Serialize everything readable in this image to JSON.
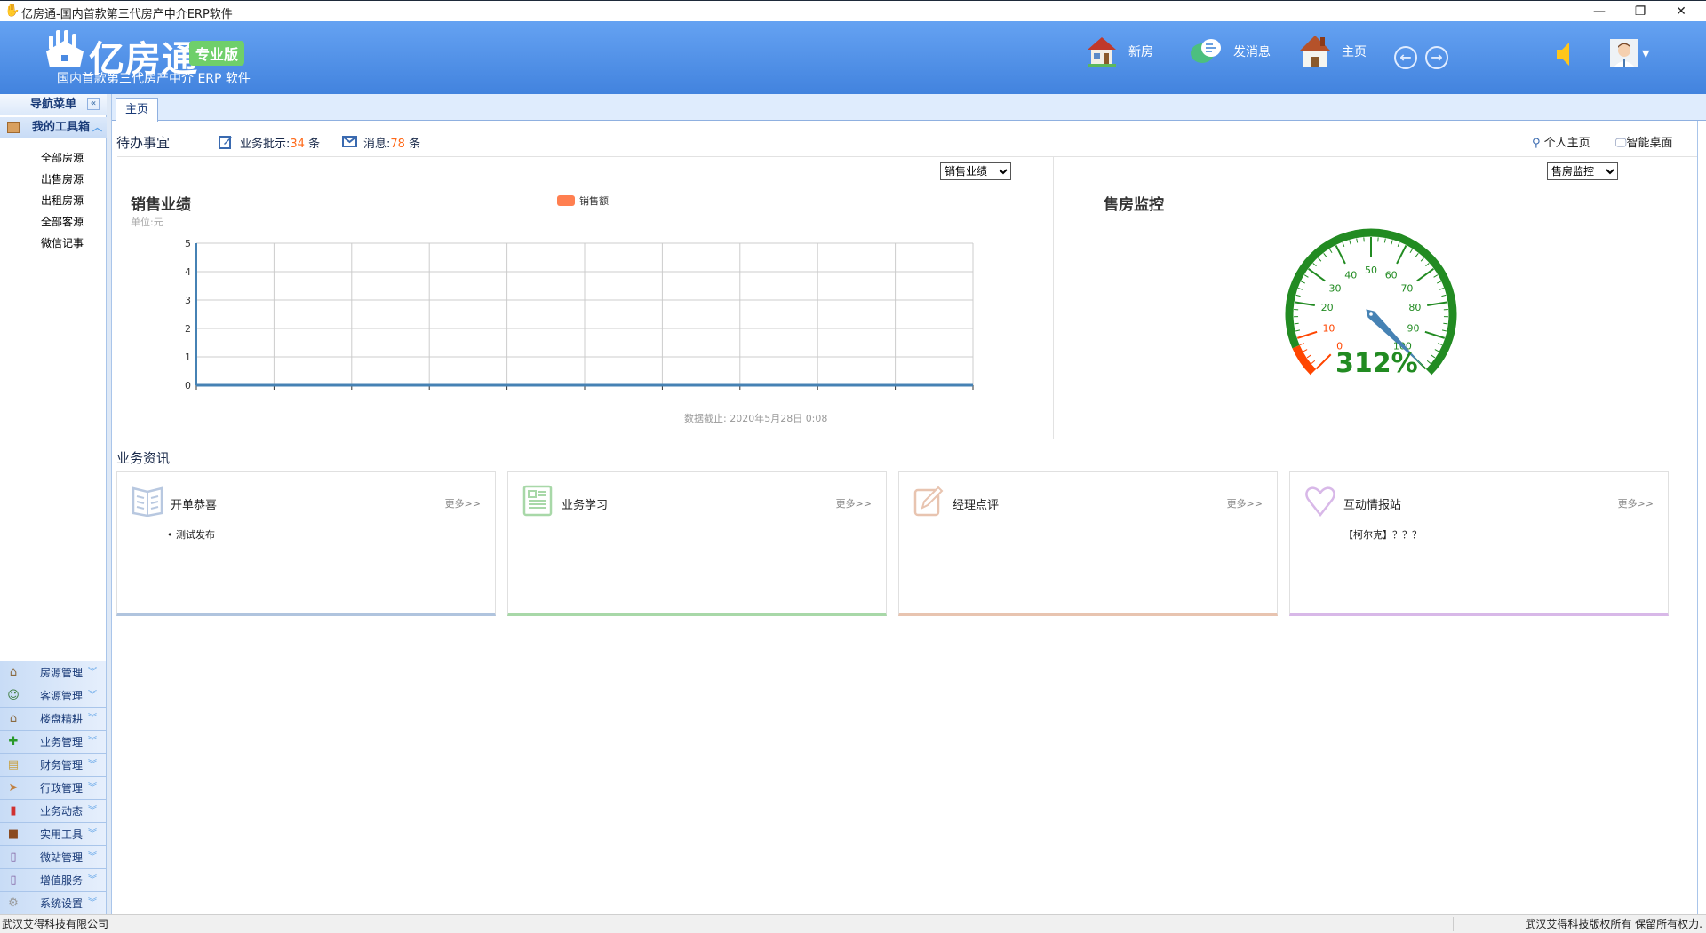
{
  "window": {
    "title": "亿房通-国内首款第三代房产中介ERP软件",
    "minimize": "—",
    "restore": "❐",
    "close": "✕"
  },
  "header": {
    "logo_text": "亿房通",
    "edition": "专业版",
    "slogan": "国内首款第三代房产中介 ERP 软件",
    "buttons": [
      {
        "label": "新房",
        "icon": "house-icon"
      },
      {
        "label": "发消息",
        "icon": "chat-bubble-icon"
      },
      {
        "label": "主页",
        "icon": "home-icon"
      }
    ],
    "back": "←",
    "forward": "→"
  },
  "sidebar": {
    "title": "导航菜单",
    "collapse": "«",
    "toolbox": {
      "label": "我的工具箱",
      "items": [
        "全部房源",
        "出售房源",
        "出租房源",
        "全部客源",
        "微信记事"
      ]
    },
    "sections": [
      {
        "label": "房源管理",
        "icon": "⌂",
        "color": "#8a6a40"
      },
      {
        "label": "客源管理",
        "icon": "☺",
        "color": "#3a7a3a"
      },
      {
        "label": "楼盘精耕",
        "icon": "⌂",
        "color": "#8a6a40"
      },
      {
        "label": "业务管理",
        "icon": "✚",
        "color": "#2a9a2a"
      },
      {
        "label": "财务管理",
        "icon": "▤",
        "color": "#c8a040"
      },
      {
        "label": "行政管理",
        "icon": "➤",
        "color": "#c08040"
      },
      {
        "label": "业务动态",
        "icon": "▮",
        "color": "#d03030"
      },
      {
        "label": "实用工具",
        "icon": "■",
        "color": "#8a4a20"
      },
      {
        "label": "微站管理",
        "icon": "▯",
        "color": "#8060a0"
      },
      {
        "label": "增值服务",
        "icon": "▯",
        "color": "#8060a0"
      },
      {
        "label": "系统设置",
        "icon": "⚙",
        "color": "#999999"
      }
    ]
  },
  "tabs": [
    {
      "label": "主页"
    }
  ],
  "todo": {
    "title": "待办事宜",
    "approval_label": "业务批示:",
    "approval_count": "34",
    "approval_unit": "条",
    "msg_label": "消息:",
    "msg_count": "78",
    "msg_unit": "条",
    "personal": "个人主页",
    "desktop": "智能桌面"
  },
  "sales": {
    "select": "销售业绩",
    "title": "销售业绩",
    "unit": "单位:元",
    "legend": "销售额",
    "as_of": "数据截止:  2020年5月28日 0:08"
  },
  "monitor": {
    "select": "售房监控",
    "title": "售房监控",
    "value_text": "312%",
    "value": 312,
    "labels": [
      "0",
      "10",
      "20",
      "30",
      "40",
      "50",
      "60",
      "70",
      "80",
      "90",
      "100"
    ]
  },
  "colors": {
    "accent": "#4283de",
    "orange": "#ff7f50",
    "gauge_green": "#228b22",
    "gauge_red": "#ff4500",
    "needle": "#4682b4"
  },
  "chart_data": {
    "type": "line",
    "title": "销售业绩",
    "ylabel": "单位:元",
    "legend": [
      "销售额"
    ],
    "yticks": [
      0,
      1,
      2,
      3,
      4,
      5
    ],
    "ylim": [
      0,
      5
    ],
    "x_categories": 10,
    "series": [
      {
        "name": "销售额",
        "values": [
          0,
          0,
          0,
          0,
          0,
          0,
          0,
          0,
          0,
          0,
          0
        ]
      }
    ],
    "grid": true
  },
  "news": {
    "title": "业务资讯",
    "cards": [
      {
        "title": "开单恭喜",
        "more": "更多>>",
        "items": [
          "测试发布"
        ],
        "color": "#b0c4de"
      },
      {
        "title": "业务学习",
        "more": "更多>>",
        "items": [],
        "color": "#a8d8a8"
      },
      {
        "title": "经理点评",
        "more": "更多>>",
        "items": [],
        "color": "#e8c4b0"
      },
      {
        "title": "互动情报站",
        "more": "更多>>",
        "items": [
          "【柯尔克】？？？"
        ],
        "color": "#d8b8e8"
      }
    ]
  },
  "status": {
    "left": "武汉艾得科技有限公司",
    "right": "武汉艾得科技版权所有 保留所有权力."
  }
}
